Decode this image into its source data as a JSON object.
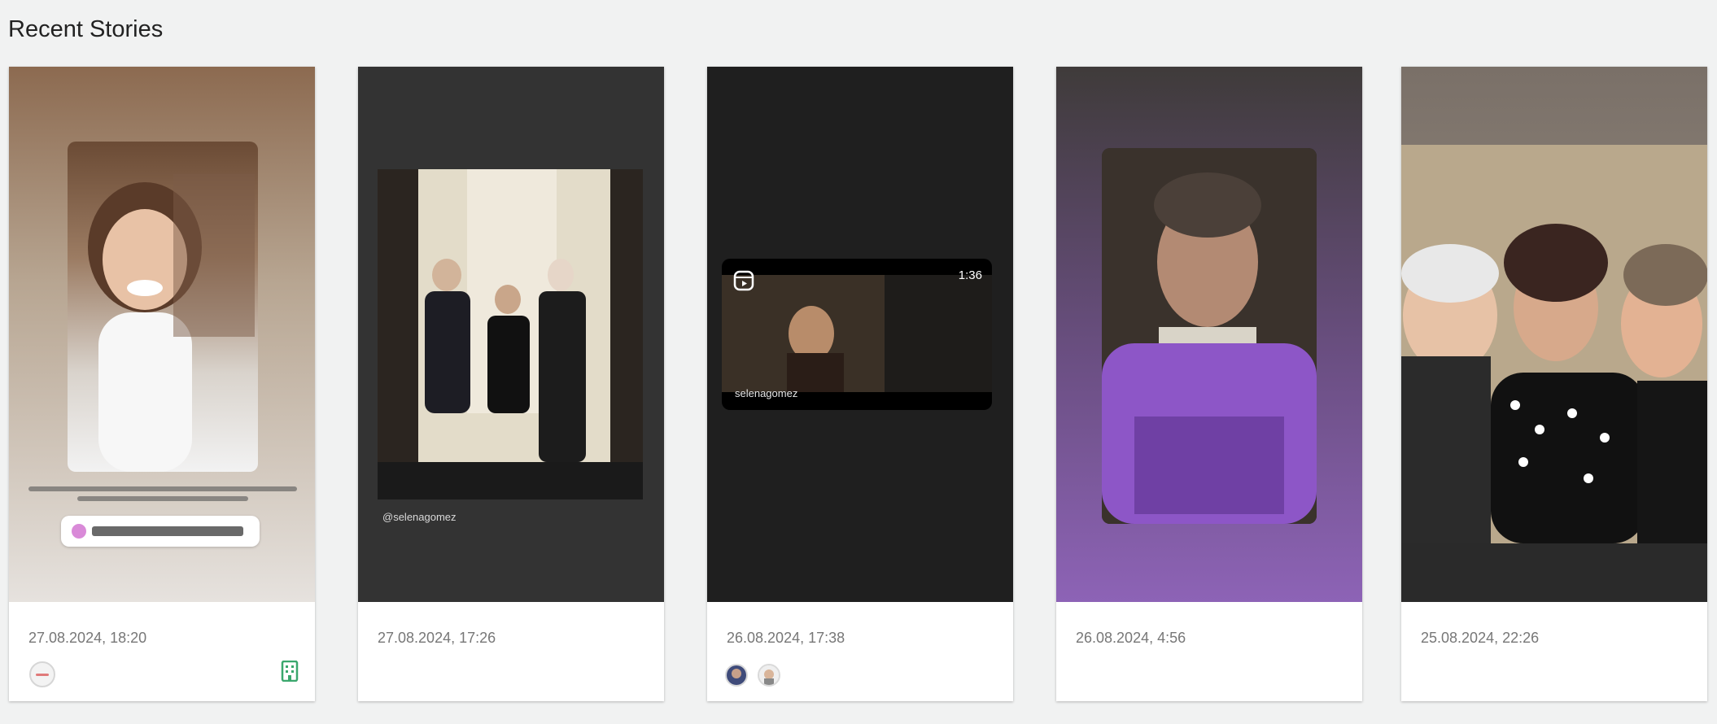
{
  "section": {
    "title": "Recent Stories"
  },
  "stories": [
    {
      "date": "27.08.2024, 18:20"
    },
    {
      "date": "27.08.2024, 17:26",
      "overlay_handle": "@selenagomez"
    },
    {
      "date": "26.08.2024, 17:38",
      "reel_duration": "1:36",
      "reel_handle": "selenagomez"
    },
    {
      "date": "26.08.2024, 4:56"
    },
    {
      "date": "25.08.2024, 22:26"
    }
  ],
  "icons": {
    "card1_left": "minus-circle-icon",
    "card1_right": "building-icon",
    "card3_avatars": [
      "avatar-1",
      "avatar-2"
    ]
  },
  "colors": {
    "page_bg": "#f1f2f2",
    "date_text": "#777777",
    "accent_green": "#3aa76d",
    "accent_red": "#e07a7a"
  }
}
